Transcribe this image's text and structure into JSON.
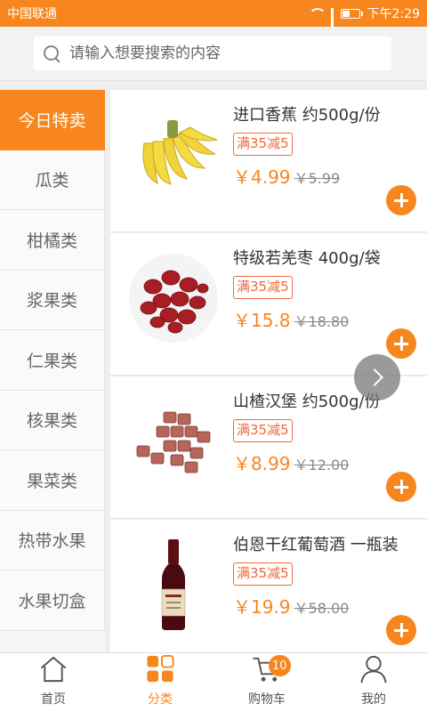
{
  "status_bar": {
    "carrier": "中国联通",
    "time": "下午2:29",
    "network": "3G"
  },
  "search": {
    "placeholder": "请输入想要搜索的内容"
  },
  "sidebar": {
    "items": [
      {
        "label": "今日特卖",
        "active": true
      },
      {
        "label": "瓜类"
      },
      {
        "label": "柑橘类"
      },
      {
        "label": "浆果类"
      },
      {
        "label": "仁果类"
      },
      {
        "label": "核果类"
      },
      {
        "label": "果菜类"
      },
      {
        "label": "热带水果"
      },
      {
        "label": "水果切盒"
      }
    ]
  },
  "products": [
    {
      "name": "进口香蕉 约500g/份",
      "tag": "满35减5",
      "price": "￥4.99",
      "old_price": "￥5.99",
      "image": "banana"
    },
    {
      "name": "特级若羌枣 400g/袋",
      "tag": "满35减5",
      "price": "￥15.8",
      "old_price": "￥18.80",
      "image": "red-dates"
    },
    {
      "name": "山楂汉堡 约500g/份",
      "tag": "满35减5",
      "price": "￥8.99",
      "old_price": "￥12.00",
      "image": "hawthorn-cubes"
    },
    {
      "name": "伯恩干红葡萄酒 一瓶装",
      "tag": "满35减5",
      "price": "￥19.9",
      "old_price": "￥58.00",
      "image": "red-wine"
    }
  ],
  "tabbar": {
    "items": [
      {
        "label": "首页",
        "icon": "home-icon"
      },
      {
        "label": "分类",
        "icon": "category-icon",
        "active": true
      },
      {
        "label": "购物车",
        "icon": "cart-icon",
        "badge": "10"
      },
      {
        "label": "我的",
        "icon": "user-icon"
      }
    ]
  },
  "colors": {
    "accent": "#f7861e",
    "tag": "#ee6a3c",
    "text": "#333333"
  }
}
